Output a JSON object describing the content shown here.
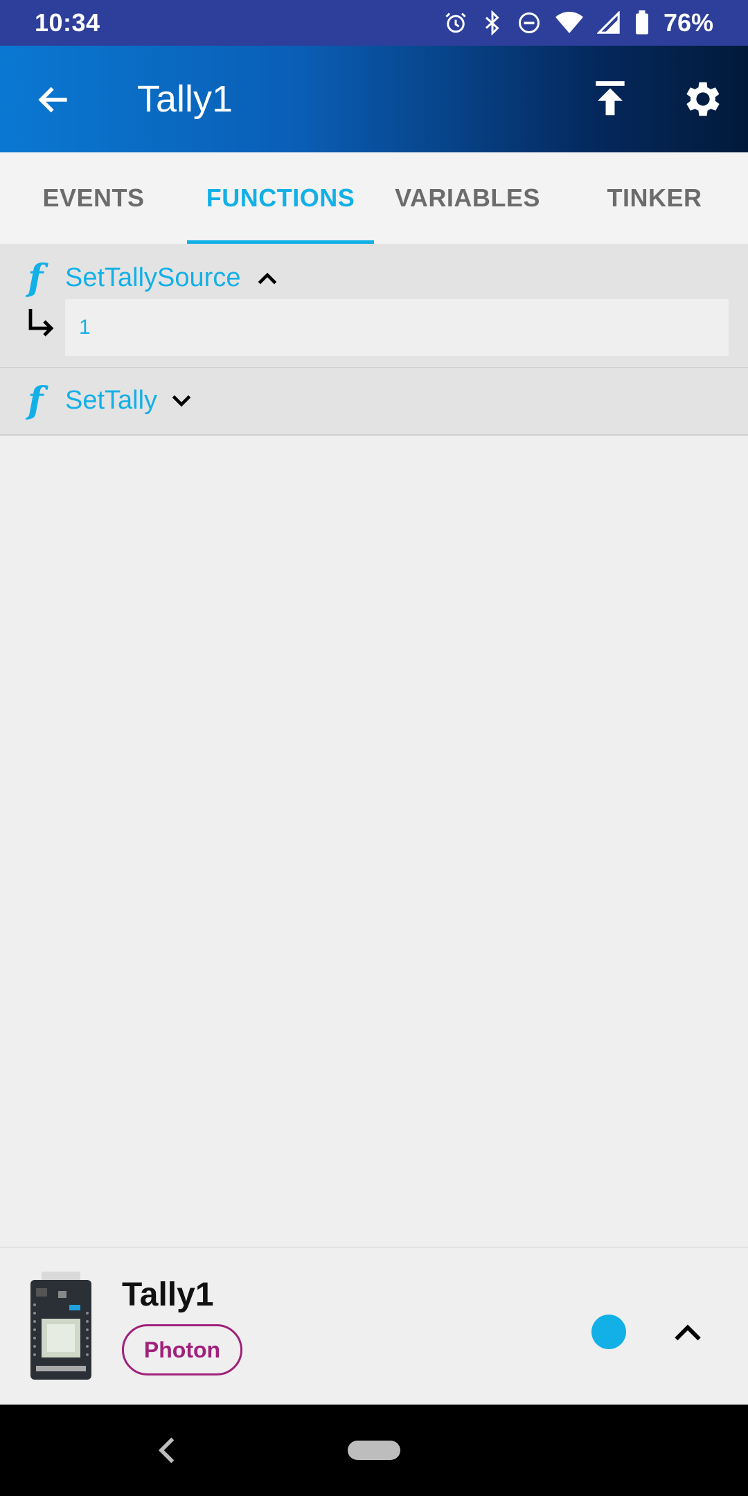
{
  "status_bar": {
    "time": "10:34",
    "battery_percent": "76%",
    "icons": [
      "alarm-icon",
      "bluetooth-icon",
      "do-not-disturb-icon",
      "wifi-icon",
      "signal-icon",
      "battery-icon"
    ]
  },
  "app_bar": {
    "title": "Tally1",
    "back_icon": "arrow-back-icon",
    "actions": [
      "upload-icon",
      "gear-icon"
    ]
  },
  "tabs": [
    {
      "label": "EVENTS",
      "active": false
    },
    {
      "label": "FUNCTIONS",
      "active": true
    },
    {
      "label": "VARIABLES",
      "active": false
    },
    {
      "label": "TINKER",
      "active": false
    }
  ],
  "functions": [
    {
      "glyph": "f",
      "name": "SetTallySource",
      "expanded": true,
      "argument_value": "1"
    },
    {
      "glyph": "f",
      "name": "SetTally",
      "expanded": false
    }
  ],
  "device": {
    "name": "Tally1",
    "type": "Photon",
    "status_color": "#12b0e6"
  },
  "colors": {
    "accent": "#12b0e6",
    "badge": "#a0207a",
    "status_bar": "#2d3f9a"
  }
}
